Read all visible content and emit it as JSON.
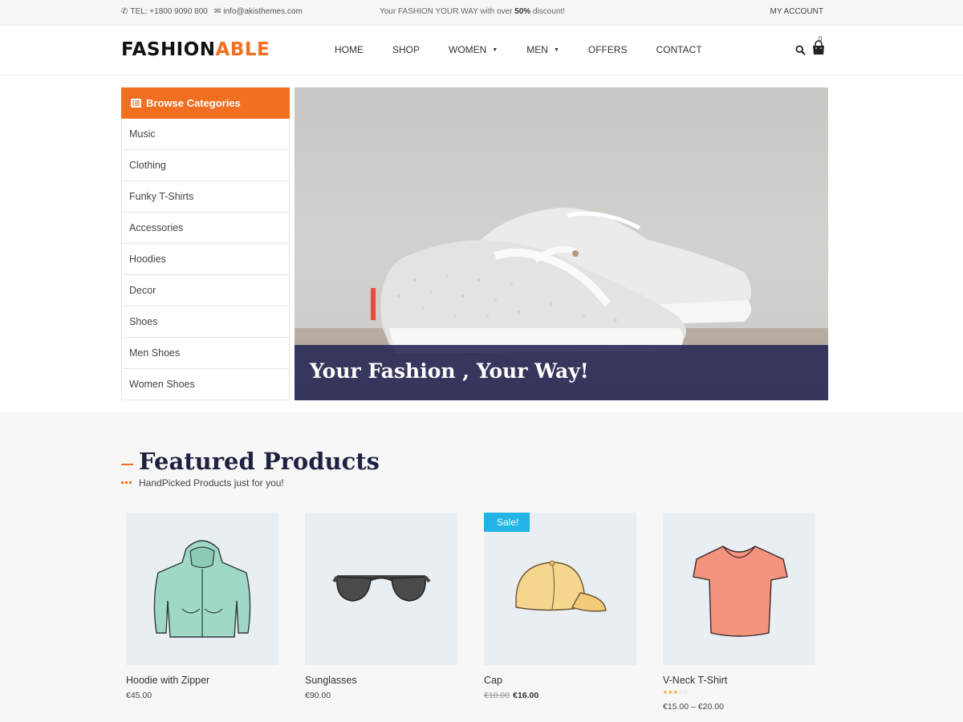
{
  "topbar": {
    "phone": "TEL: +1800 9090 800",
    "email": "info@akisthemes.com",
    "promo_prefix": "Your FASHION YOUR WAY with over ",
    "promo_bold": "50%",
    "promo_suffix": " discount!",
    "account": "MY ACCOUNT"
  },
  "header": {
    "logo_main": "FASHION",
    "logo_accent": "ABLE",
    "cart_count": "0",
    "nav": [
      {
        "label": "HOME"
      },
      {
        "label": "SHOP"
      },
      {
        "label": "WOMEN"
      },
      {
        "label": "MEN"
      },
      {
        "label": "OFFERS"
      },
      {
        "label": "CONTACT"
      }
    ]
  },
  "sidebar": {
    "title": "Browse Categories",
    "items": [
      "Music",
      "Clothing",
      "Funky T-Shirts",
      "Accessories",
      "Hoodies",
      "Decor",
      "Shoes",
      "Men Shoes",
      "Women Shoes"
    ]
  },
  "hero": {
    "caption": "Your Fashion , Your Way!"
  },
  "featured": {
    "title": "Featured Products",
    "subtitle": "HandPicked Products just for you!",
    "products": [
      {
        "name": "Hoodie with Zipper",
        "price": "€45.00",
        "old_price": "",
        "sale": "",
        "rating": ""
      },
      {
        "name": "Sunglasses",
        "price": "€90.00",
        "old_price": "",
        "sale": "",
        "rating": ""
      },
      {
        "name": "Cap",
        "price": "€16.00",
        "old_price": "€18.00",
        "sale": "Sale!",
        "rating": ""
      },
      {
        "name": "V-Neck T-Shirt",
        "price": "€15.00 – €20.00",
        "old_price": "",
        "sale": "",
        "rating": 3
      }
    ]
  },
  "colors": {
    "accent": "#f26f21",
    "caption_bg": "#2c2c58",
    "sale_badge": "#23b4e5",
    "title": "#1e2240"
  }
}
